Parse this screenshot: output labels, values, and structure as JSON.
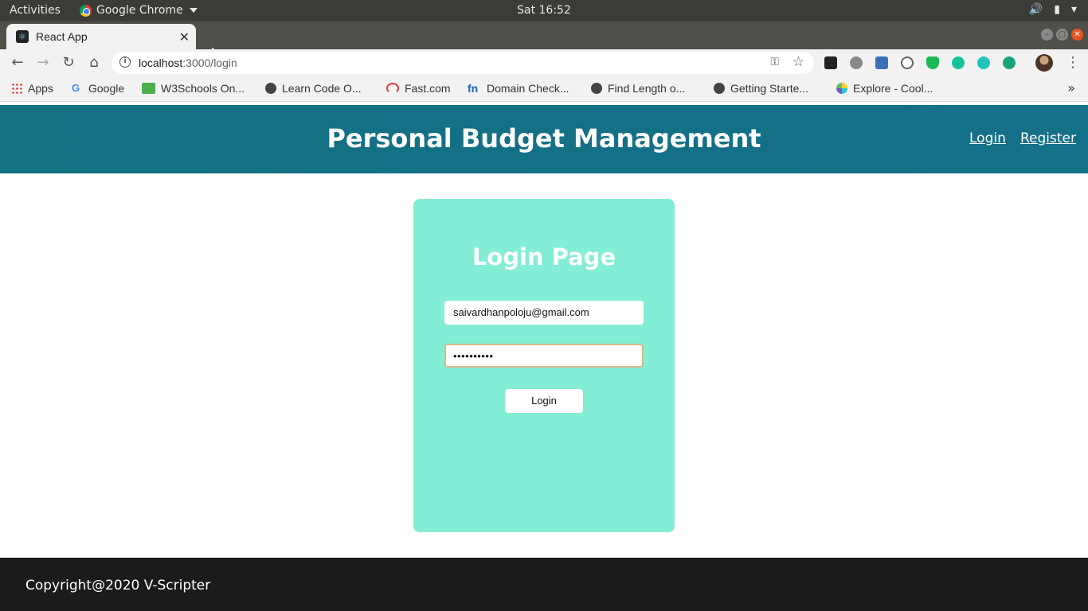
{
  "system_bar": {
    "activities": "Activities",
    "app_name": "Google Chrome",
    "clock": "Sat 16:52"
  },
  "browser": {
    "tab_title": "React App",
    "url_host": "localhost",
    "url_path": ":3000/login",
    "bookmarks": [
      {
        "label": "Apps",
        "icon": "apps-grid-icon"
      },
      {
        "label": "Google",
        "icon": "google-icon"
      },
      {
        "label": "W3Schools On...",
        "icon": "w3schools-icon"
      },
      {
        "label": "Learn Code O...",
        "icon": "globe-icon"
      },
      {
        "label": "Fast.com",
        "icon": "speedometer-icon"
      },
      {
        "label": "Domain Check...",
        "icon": "fn-icon"
      },
      {
        "label": "Find Length o...",
        "icon": "globe-icon"
      },
      {
        "label": "Getting Starte...",
        "icon": "globe-icon"
      },
      {
        "label": "Explore - Cool...",
        "icon": "colorful-c-icon"
      }
    ]
  },
  "site": {
    "title": "Personal Budget Management",
    "nav": {
      "login": "Login",
      "register": "Register"
    },
    "header_color": "#137180"
  },
  "login_card": {
    "title": "Login Page",
    "email_value": "saivardhanpoloju@gmail.com",
    "password_value": "••••••••••",
    "button_label": "Login",
    "card_color": "#84edd6"
  },
  "footer": {
    "text": "Copyright@2020 V-Scripter"
  }
}
